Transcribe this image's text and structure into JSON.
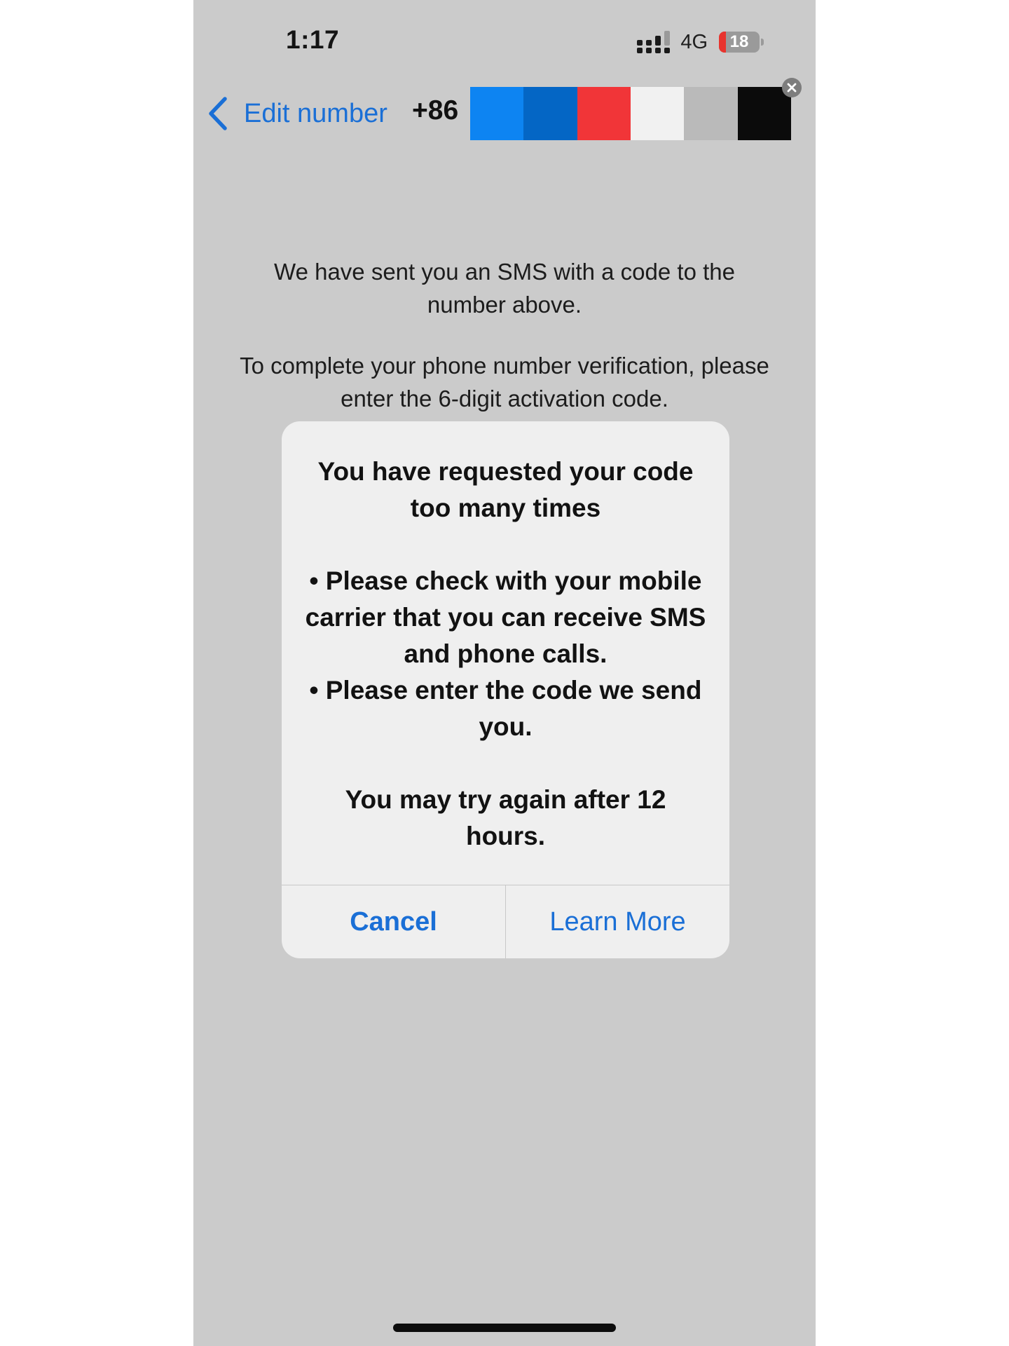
{
  "status_bar": {
    "time": "1:17",
    "network": "4G",
    "battery_text": "18",
    "battery_level": 0.18,
    "battery_color": "#e8342e"
  },
  "nav": {
    "back_label": "Edit number",
    "back_icon": "chevron-left-icon",
    "country_code": "+86",
    "redaction_colors": [
      "#0d84f2",
      "#0466c5",
      "#f13538",
      "#f1f1f1",
      "#bababa",
      "#0b0b0b"
    ],
    "clear_icon": "close-icon"
  },
  "instructions": {
    "line1": "We have sent you an SMS with a code to the number above.",
    "line2": "To complete your phone number verification, please enter the 6-digit activation code."
  },
  "alert": {
    "title": "You have requested your code too many times",
    "bullet1": "• Please check with your mobile carrier that you can receive SMS and phone calls.",
    "bullet2": "• Please enter the code we send you.",
    "retry": "You may try again after 12 hours.",
    "cancel_label": "Cancel",
    "learn_more_label": "Learn More"
  },
  "colors": {
    "accent": "#1a6fd6",
    "screen_background": "#cbcbcb",
    "alert_background": "#efefef"
  }
}
